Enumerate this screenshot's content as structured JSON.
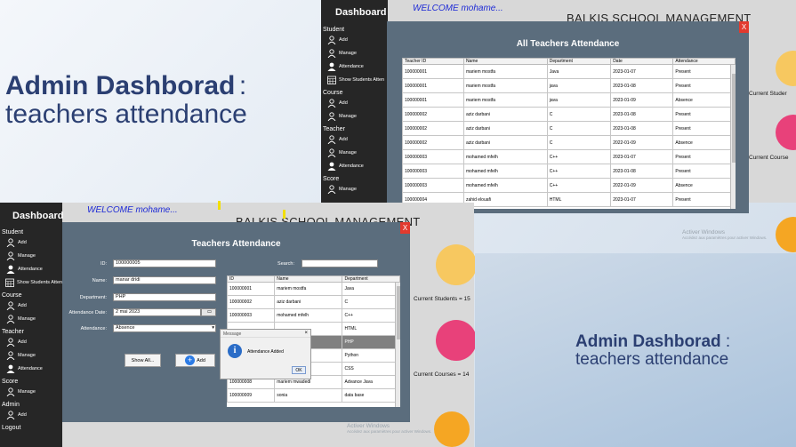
{
  "slide": {
    "title_bold": "Admin Dashborad",
    "colon": ":",
    "title_sub": "teachers attendance"
  },
  "win1": {
    "dashboard_title": "Dashboard",
    "welcome": "WELCOME mohame...",
    "brand": "BALKIS SCHOOL MANAGEMENT",
    "sidebar": [
      {
        "section": "Student",
        "items": [
          {
            "label": "Add",
            "icon": "user-add-icon"
          },
          {
            "label": "Manage",
            "icon": "user-manage-icon"
          },
          {
            "label": "Attendance",
            "icon": "user-icon"
          },
          {
            "label": "Show Students Atten",
            "icon": "calendar-icon"
          }
        ]
      },
      {
        "section": "Course",
        "items": [
          {
            "label": "Add",
            "icon": "user-add-icon"
          },
          {
            "label": "Manage",
            "icon": "user-manage-icon"
          }
        ]
      },
      {
        "section": "Teacher",
        "items": [
          {
            "label": "Add",
            "icon": "user-add-icon"
          },
          {
            "label": "Manage",
            "icon": "user-manage-icon"
          },
          {
            "label": "Attendance",
            "icon": "user-icon"
          }
        ]
      },
      {
        "section": "Score",
        "items": [
          {
            "label": "Manage",
            "icon": "user-manage-icon"
          }
        ]
      }
    ],
    "dialog": {
      "title": "All Teachers Attendance",
      "close": "X",
      "columns": [
        "Teacher ID",
        "Name",
        "Department",
        "Date",
        "Attendance"
      ],
      "rows": [
        [
          "100000001",
          "mariem mostfa",
          "Java",
          "2023-01-07",
          "Present"
        ],
        [
          "100000001",
          "mariem mostfa",
          "java",
          "2023-01-08",
          "Present"
        ],
        [
          "100000001",
          "mariem mostfa",
          "java",
          "2023-01-09",
          "Absence"
        ],
        [
          "100000002",
          "aziz darbani",
          "C",
          "2023-01-08",
          "Present"
        ],
        [
          "100000002",
          "aziz darbani",
          "C",
          "2023-01-08",
          "Present"
        ],
        [
          "100000002",
          "aziz darbani",
          "C",
          "2022-01-09",
          "Absence"
        ],
        [
          "100000003",
          "mohamed mfelh",
          "C++",
          "2023-01-07",
          "Present"
        ],
        [
          "100000003",
          "mohamed mfelh",
          "C++",
          "2023-01-08",
          "Present"
        ],
        [
          "100000003",
          "mohamed mfelh",
          "C++",
          "2022-01-09",
          "Absence"
        ],
        [
          "100000004",
          "zahid elouafi",
          "HTML",
          "2023-01-07",
          "Present"
        ]
      ]
    },
    "right": {
      "students_label": "Current Studer",
      "courses_label": "Current Course"
    },
    "activate": {
      "title": "Activer Windows",
      "sub": "Accédez aux paramètres pour activer Windows."
    }
  },
  "win2": {
    "dashboard_title": "Dashboard",
    "welcome": "WELCOME mohame...",
    "brand": "BALKIS SCHOOL MANAGEMENT",
    "sidebar": [
      {
        "section": "Student",
        "items": [
          {
            "label": "Add",
            "icon": "user-add-icon"
          },
          {
            "label": "Manage",
            "icon": "user-manage-icon"
          },
          {
            "label": "Attendance",
            "icon": "user-icon"
          },
          {
            "label": "Show Students Atten",
            "icon": "calendar-icon"
          }
        ]
      },
      {
        "section": "Course",
        "items": [
          {
            "label": "Add",
            "icon": "user-add-icon"
          },
          {
            "label": "Manage",
            "icon": "user-manage-icon"
          }
        ]
      },
      {
        "section": "Teacher",
        "items": [
          {
            "label": "Add",
            "icon": "user-add-icon"
          },
          {
            "label": "Manage",
            "icon": "user-manage-icon"
          },
          {
            "label": "Attendance",
            "icon": "user-icon"
          }
        ]
      },
      {
        "section": "Score",
        "items": [
          {
            "label": "Manage",
            "icon": "user-manage-icon"
          }
        ]
      },
      {
        "section": "Admin",
        "items": [
          {
            "label": "Add",
            "icon": "user-add-icon"
          }
        ]
      },
      {
        "section": "Logout",
        "items": []
      }
    ],
    "dialog": {
      "title": "Teachers Attendance",
      "close": "X",
      "form": {
        "id_label": "ID:",
        "id_value": "100000005",
        "name_label": "Name:",
        "name_value": "manar dridi",
        "dept_label": "Department:",
        "dept_value": "PHP",
        "date_label": "Attendance Date:",
        "date_value": "2 mai 2023",
        "att_label": "Attendance:",
        "att_value": "Absence",
        "search_label": "Search:",
        "search_value": ""
      },
      "show_all": "Show All...",
      "add": "Add",
      "columns": [
        "ID",
        "Name",
        "Department"
      ],
      "rows": [
        [
          "100000001",
          "mariem mostfa",
          "Java"
        ],
        [
          "100000002",
          "aziz darbani",
          "C"
        ],
        [
          "100000003",
          "mohamed mfelh",
          "C++"
        ],
        [
          "",
          "",
          "HTML"
        ],
        [
          "",
          "",
          "PHP"
        ],
        [
          "",
          "",
          "Python"
        ],
        [
          "",
          "",
          "CSS"
        ],
        [
          "100000008",
          "mariem mwadedi",
          "Advance Java"
        ],
        [
          "100000009",
          "sonia",
          "data base"
        ]
      ],
      "selected_row": 4
    },
    "message": {
      "head": "Message",
      "text": "Attendance Added",
      "ok": "OK"
    },
    "right": {
      "students_label": "Current Students = 15",
      "courses_label": "Current Courses = 14"
    },
    "activate": {
      "title": "Activer Windows",
      "sub": "Accédez aux paramètres pour activer Windows."
    }
  },
  "card2": {
    "title_bold": "Admin Dashborad",
    "colon": ":",
    "title_sub": "teachers attendance"
  }
}
